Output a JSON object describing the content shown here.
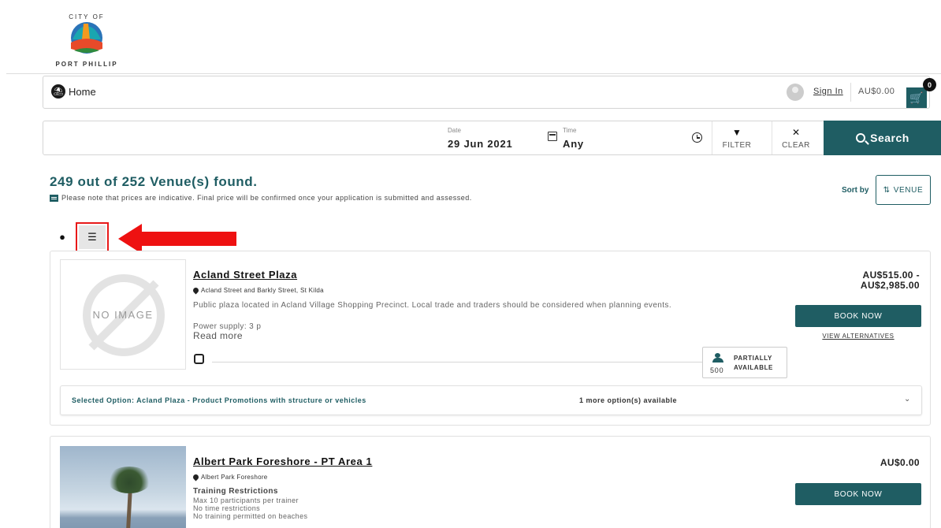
{
  "brand": {
    "logo_text": "CITY OF PORT PHILLIP",
    "accent": "#1f5d63",
    "annotation": "#ee1111"
  },
  "nav": {
    "home_label": "Home",
    "sign_in": "Sign In",
    "cart_total": "AU$0.00",
    "cart_count": "0"
  },
  "search": {
    "date_label": "Date",
    "date_value": "29 Jun 2021",
    "time_label": "Time",
    "time_value": "Any",
    "filter_label": "FILTER",
    "clear_label": "CLEAR",
    "search_label": "Search"
  },
  "results": {
    "count_text": "249 out of 252 Venue(s) found.",
    "note": "Please note that prices are indicative. Final price will be confirmed once your application is submitted and assessed.",
    "sort_by_label": "Sort by",
    "sort_value": "VENUE"
  },
  "venues": [
    {
      "name": "Acland Street Plaza",
      "address": "Acland Street and Barkly Street, St Kilda",
      "image_text": "NO IMAGE",
      "description": "Public plaza located in Acland Village Shopping Precinct. Local trade and traders should be considered when planning events.",
      "power": "Power supply: 3 p",
      "read_more": "Read more",
      "capacity": "500",
      "availability": "PARTIALLY AVAILABLE",
      "price": "AU$515.00 - AU$2,985.00",
      "book_label": "BOOK NOW",
      "alternatives_label": "VIEW ALTERNATIVES",
      "selected_option": "Selected Option: Acland Plaza - Product Promotions with structure or vehicles",
      "more_options": "1 more option(s) available"
    },
    {
      "name": "Albert Park Foreshore - PT Area 1",
      "address": "Albert Park Foreshore",
      "restrictions_title": "Training Restrictions",
      "restrictions": [
        "Max 10 participants per trainer",
        "No time restrictions",
        "No training permitted on beaches"
      ],
      "price": "AU$0.00",
      "book_label": "BOOK NOW"
    }
  ]
}
